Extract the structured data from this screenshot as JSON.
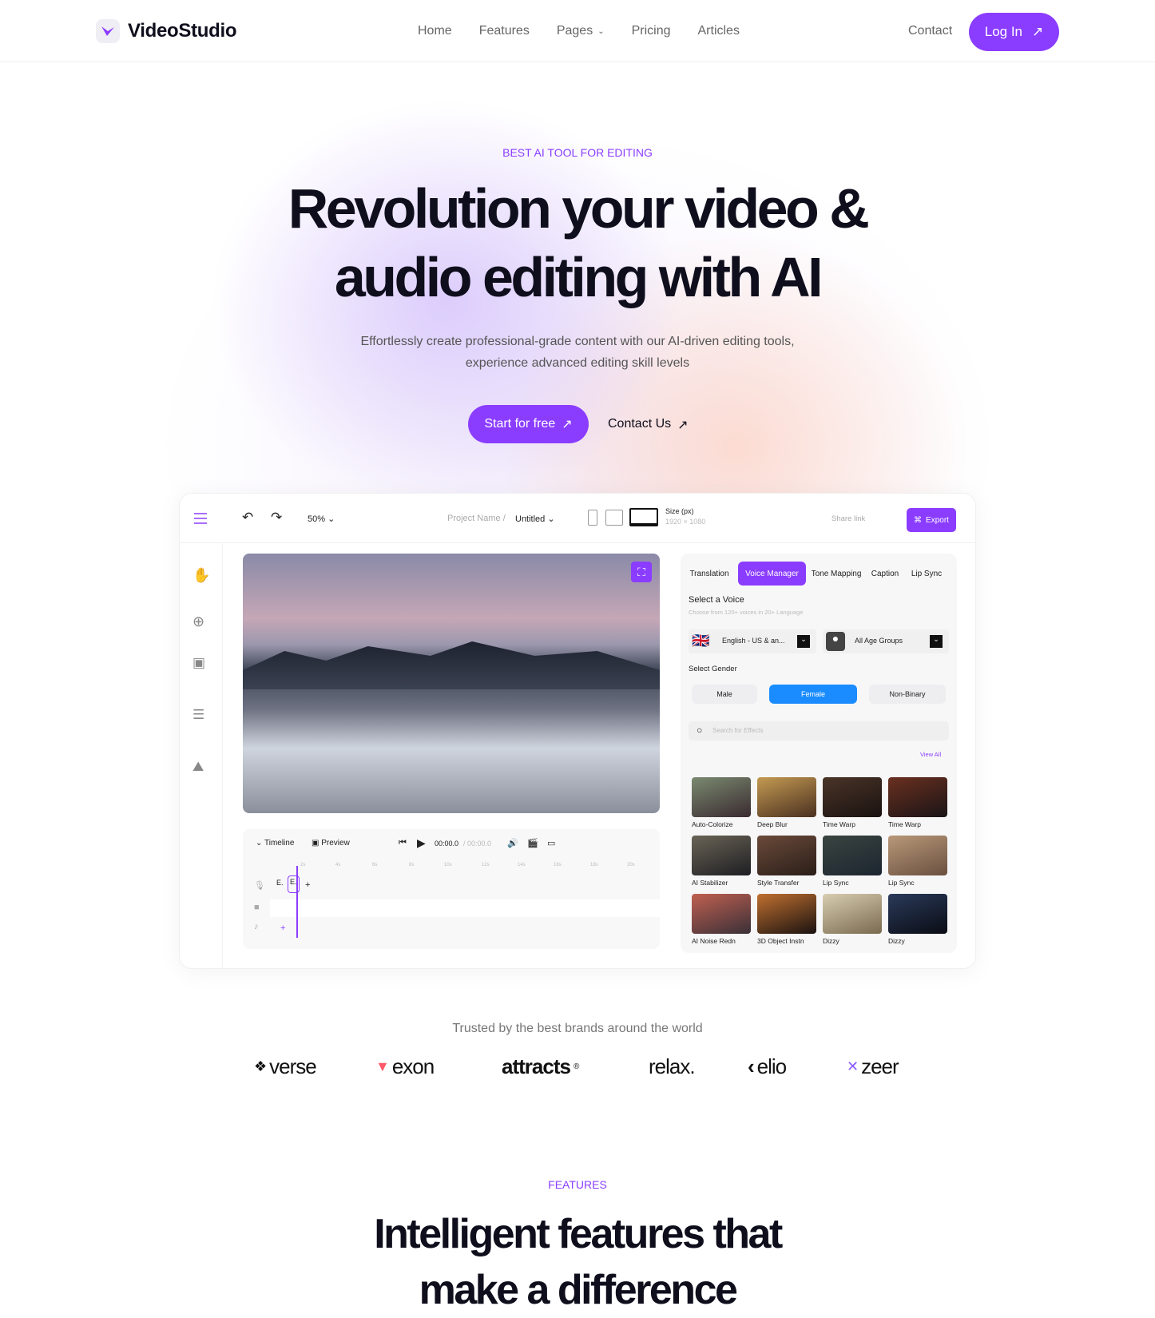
{
  "nav": {
    "brand": "VideoStudio",
    "items": [
      "Home",
      "Features",
      "Pages",
      "Pricing",
      "Articles"
    ],
    "contact": "Contact",
    "login": "Log In"
  },
  "hero": {
    "kicker": "BEST AI TOOL FOR EDITING",
    "title_line1": "Revolution your video &",
    "title_line2": "audio editing with AI",
    "subtitle_line1": "Effortlessly create professional-grade content with our AI-driven editing tools,",
    "subtitle_line2": "experience advanced editing skill levels",
    "cta_primary": "Start for free",
    "cta_secondary": "Contact Us"
  },
  "editor": {
    "zoom": "50%",
    "project_label": "Project Name /",
    "project_name": "Untitled",
    "size_label": "Size (px)",
    "size_value": "1920 × 1080",
    "share": "Share link",
    "export": "Export",
    "tabs": [
      "Translation",
      "Voice Manager",
      "Tone Mapping",
      "Caption",
      "Lip Sync"
    ],
    "active_tab": "Voice Manager",
    "select_voice": "Select a Voice",
    "select_voice_sub": "Choose from 120+ voices in 20+ Language",
    "language": "English - US & an...",
    "age": "All Age Groups",
    "select_gender": "Select Gender",
    "genders": [
      "Male",
      "Female",
      "Non-Binary"
    ],
    "active_gender": "Female",
    "search_placeholder": "Search for Effects",
    "view_all": "View All",
    "effects": [
      {
        "label": "Auto-Colorize",
        "c1": "#7a8a70",
        "c2": "#3a2a30"
      },
      {
        "label": "Deep Blur",
        "c1": "#c49a52",
        "c2": "#4a3020"
      },
      {
        "label": "Time Warp",
        "c1": "#4a3428",
        "c2": "#1a1210"
      },
      {
        "label": "Time Warp",
        "c1": "#6a3020",
        "c2": "#1a1416"
      },
      {
        "label": "AI Stabilizer",
        "c1": "#6a6456",
        "c2": "#1e1e22"
      },
      {
        "label": "Style Transfer",
        "c1": "#6a4a3a",
        "c2": "#2a1e18"
      },
      {
        "label": "Lip Sync",
        "c1": "#3a4440",
        "c2": "#1c2630"
      },
      {
        "label": "Lip Sync",
        "c1": "#b89878",
        "c2": "#6a5040"
      },
      {
        "label": "AI Noise Redn",
        "c1": "#c06050",
        "c2": "#3a3038"
      },
      {
        "label": "3D Object Instn",
        "c1": "#c07030",
        "c2": "#1a1210"
      },
      {
        "label": "Dizzy",
        "c1": "#d8cdb0",
        "c2": "#7a6a50"
      },
      {
        "label": "Dizzy",
        "c1": "#2a3a5a",
        "c2": "#0a0c14"
      }
    ],
    "timeline": {
      "timeline_label": "Timeline",
      "preview_label": "Preview",
      "time_current": "00:00.0",
      "time_total": "/ 00:00.0",
      "ticks": [
        "2s",
        "4s",
        "6s",
        "8s",
        "10s",
        "12s",
        "14s",
        "16s",
        "18s",
        "20s"
      ],
      "clips": [
        "E.",
        "E."
      ]
    }
  },
  "trusted": {
    "text": "Trusted by the best brands around the world",
    "brands": [
      "verse",
      "exon",
      "attracts",
      "relax.",
      "elio",
      "zeer"
    ]
  },
  "features": {
    "kicker": "FEATURES",
    "title_line1": "Intelligent features that",
    "title_line2": "make a difference"
  },
  "colors": {
    "accent": "#8b3dff",
    "blue": "#1a8cff"
  }
}
